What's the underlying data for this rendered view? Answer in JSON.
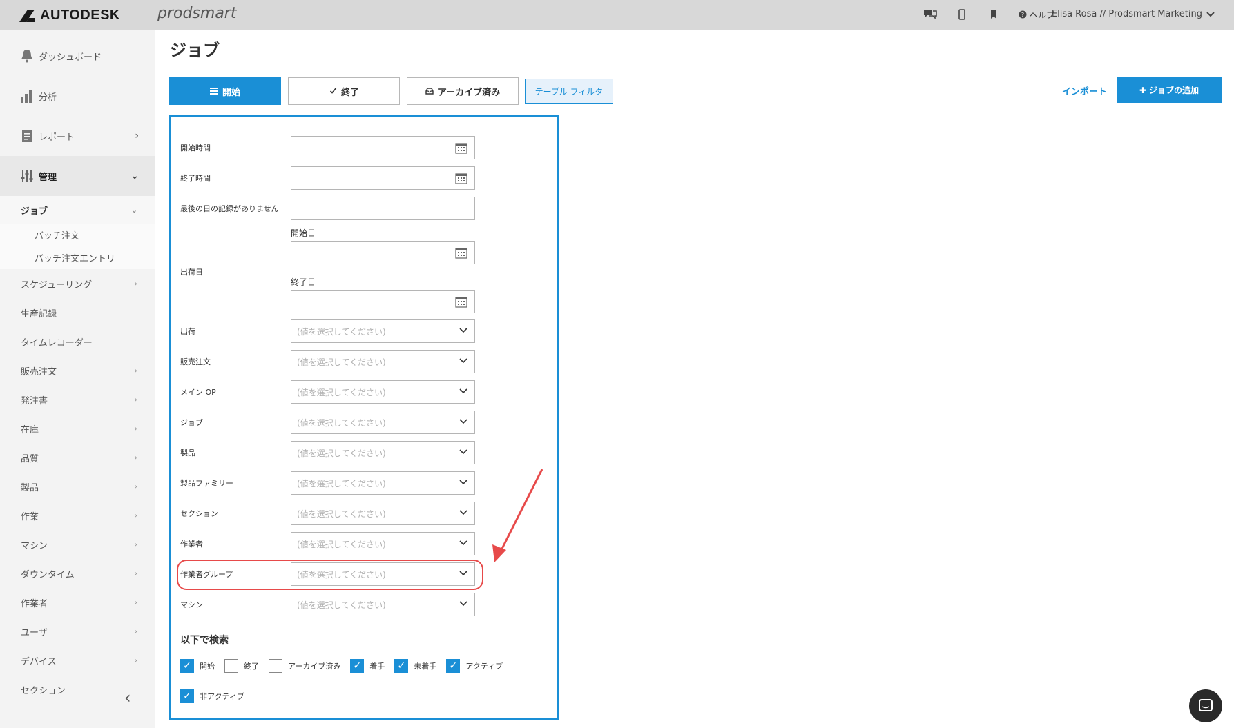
{
  "header": {
    "brand": "AUTODESK",
    "product": "prodsmart",
    "help_label": "ヘルプ",
    "user_label": "Elisa Rosa // Prodsmart Marketing"
  },
  "sidebar": {
    "top": [
      {
        "label": "ダッシュボード",
        "icon": "bell-icon"
      },
      {
        "label": "分析",
        "icon": "bar-chart-icon"
      },
      {
        "label": "レポート",
        "icon": "report-icon"
      },
      {
        "label": "管理",
        "icon": "sliders-icon"
      }
    ],
    "job": "ジョブ",
    "sub": [
      "バッチ注文",
      "バッチ注文エントリ"
    ],
    "items": [
      "スケジューリング",
      "生産記録",
      "タイムレコーダー",
      "販売注文",
      "発注書",
      "在庫",
      "品質",
      "製品",
      "作業",
      "マシン",
      "ダウンタイム",
      "作業者",
      "ユーザ",
      "デバイス",
      "セクション"
    ]
  },
  "page": {
    "title": "ジョブ",
    "tabs": [
      "開始",
      "終了",
      "アーカイブ済み"
    ],
    "filter_tab": "テーブル フィルタ",
    "import": "インポート",
    "add_job": "ジョブの追加"
  },
  "filters": {
    "start_time": "開始時間",
    "end_time": "終了時間",
    "no_last_day": "最後の日の記録がありません",
    "ship_date": "出荷日",
    "start_date": "開始日",
    "end_date": "終了日",
    "placeholder": "(値を選択してください)",
    "selects": [
      "出荷",
      "販売注文",
      "メイン OP",
      "ジョブ",
      "製品",
      "製品ファミリー",
      "セクション",
      "作業者",
      "作業者グループ",
      "マシン"
    ],
    "search_title": "以下で検索",
    "checkboxes": [
      {
        "label": "開始",
        "checked": true
      },
      {
        "label": "終了",
        "checked": false
      },
      {
        "label": "アーカイブ済み",
        "checked": false
      },
      {
        "label": "着手",
        "checked": true
      },
      {
        "label": "未着手",
        "checked": true
      },
      {
        "label": "アクティブ",
        "checked": true
      },
      {
        "label": "非アクティブ",
        "checked": true
      }
    ]
  },
  "colors": {
    "accent": "#1a8fd6",
    "highlight": "#e74a4a"
  }
}
